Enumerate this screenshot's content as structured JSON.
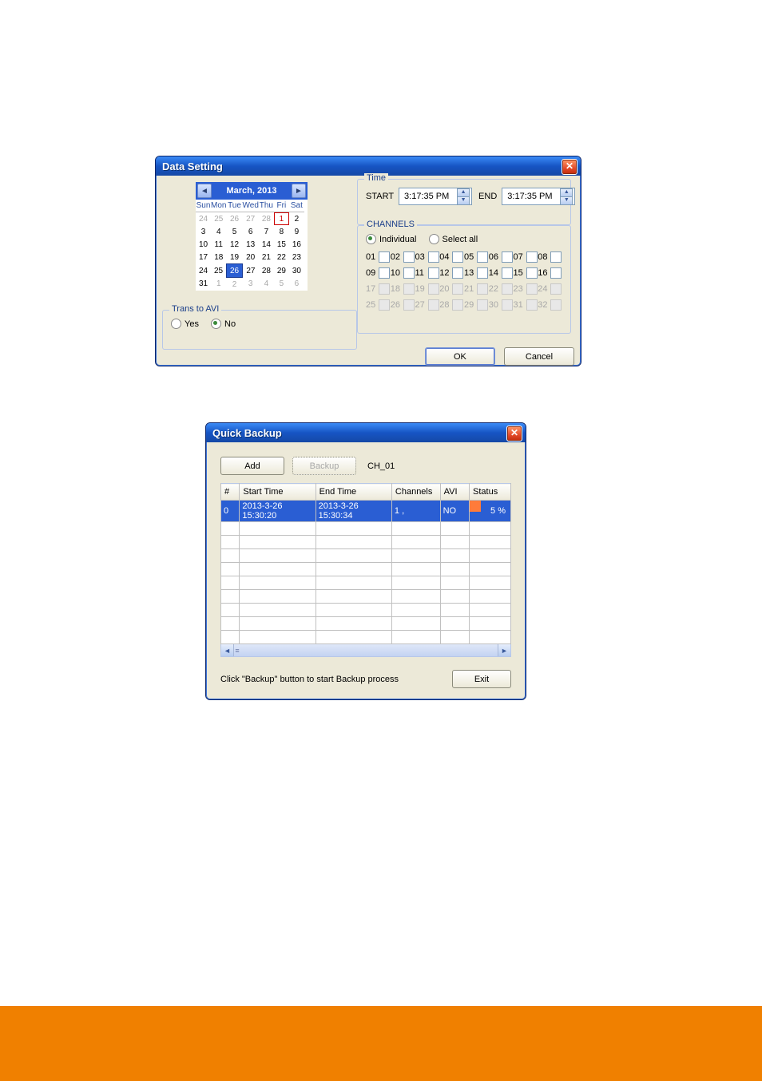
{
  "dialog1": {
    "title": "Data Setting",
    "calendar": {
      "month_label": "March, 2013",
      "days": [
        "Sun",
        "Mon",
        "Tue",
        "Wed",
        "Thu",
        "Fri",
        "Sat"
      ],
      "rows": [
        [
          {
            "n": "24",
            "dim": true
          },
          {
            "n": "25",
            "dim": true
          },
          {
            "n": "26",
            "dim": true
          },
          {
            "n": "27",
            "dim": true
          },
          {
            "n": "28",
            "dim": true
          },
          {
            "n": "1",
            "today": true
          },
          {
            "n": "2"
          }
        ],
        [
          {
            "n": "3"
          },
          {
            "n": "4"
          },
          {
            "n": "5"
          },
          {
            "n": "6"
          },
          {
            "n": "7"
          },
          {
            "n": "8"
          },
          {
            "n": "9"
          }
        ],
        [
          {
            "n": "10"
          },
          {
            "n": "11"
          },
          {
            "n": "12"
          },
          {
            "n": "13"
          },
          {
            "n": "14"
          },
          {
            "n": "15"
          },
          {
            "n": "16"
          }
        ],
        [
          {
            "n": "17"
          },
          {
            "n": "18"
          },
          {
            "n": "19"
          },
          {
            "n": "20"
          },
          {
            "n": "21"
          },
          {
            "n": "22"
          },
          {
            "n": "23"
          }
        ],
        [
          {
            "n": "24"
          },
          {
            "n": "25"
          },
          {
            "n": "26",
            "sel": true
          },
          {
            "n": "27"
          },
          {
            "n": "28"
          },
          {
            "n": "29"
          },
          {
            "n": "30"
          }
        ],
        [
          {
            "n": "31"
          },
          {
            "n": "1",
            "dim": true
          },
          {
            "n": "2",
            "dim": true
          },
          {
            "n": "3",
            "dim": true
          },
          {
            "n": "4",
            "dim": true
          },
          {
            "n": "5",
            "dim": true
          },
          {
            "n": "6",
            "dim": true
          }
        ]
      ]
    },
    "trans_to_avi": {
      "legend": "Trans to AVI",
      "yes": "Yes",
      "no": "No",
      "selected": "No"
    },
    "time": {
      "legend": "Time",
      "start_label": "START",
      "start_value": "3:17:35 PM",
      "end_label": "END",
      "end_value": "3:17:35 PM"
    },
    "channels": {
      "legend": "CHANNELS",
      "individual": "Individual",
      "select_all": "Select all",
      "mode": "Individual",
      "rows": [
        [
          "01",
          "02",
          "03",
          "04",
          "05",
          "06",
          "07",
          "08"
        ],
        [
          "09",
          "10",
          "11",
          "12",
          "13",
          "14",
          "15",
          "16"
        ],
        [
          "17",
          "18",
          "19",
          "20",
          "21",
          "22",
          "23",
          "24"
        ],
        [
          "25",
          "26",
          "27",
          "28",
          "29",
          "30",
          "31",
          "32"
        ]
      ],
      "disabled_from": 17
    },
    "buttons": {
      "ok": "OK",
      "cancel": "Cancel"
    }
  },
  "dialog2": {
    "title": "Quick Backup",
    "toolbar": {
      "add": "Add",
      "backup": "Backup",
      "channel": "CH_01"
    },
    "table": {
      "headers": [
        "#",
        "Start Time",
        "End Time",
        "Channels",
        "AVI",
        "Status"
      ],
      "row": {
        "idx": "0",
        "start": "2013-3-26 15:30:20",
        "end": "2013-3-26 15:30:34",
        "channels": "1 ,",
        "avi": "NO",
        "status": "5 %"
      }
    },
    "hint": "Click \"Backup\" button to start Backup process",
    "exit": "Exit"
  }
}
